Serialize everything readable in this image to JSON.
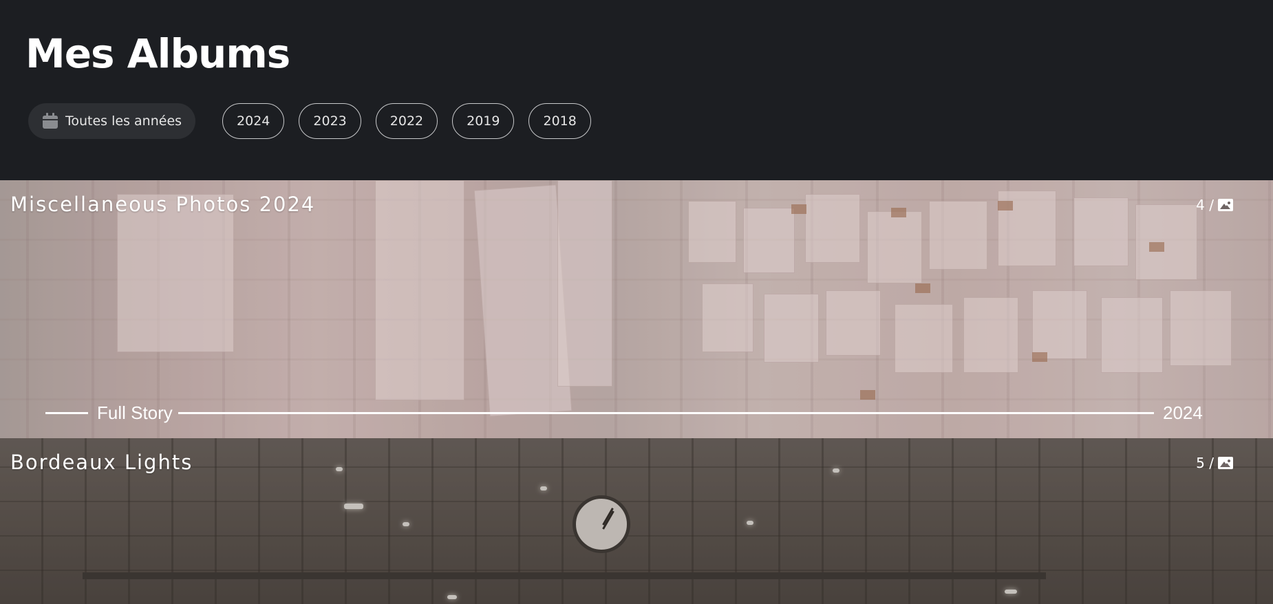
{
  "header": {
    "title": "Mes Albums",
    "filters": {
      "all_years_label": "Toutes les années",
      "all_years_icon": "calendar-icon",
      "years": [
        "2024",
        "2023",
        "2022",
        "2019",
        "2018"
      ]
    }
  },
  "albums": [
    {
      "title": "Miscellaneous Photos 2024",
      "count": "4 /",
      "count_icon": "image-icon",
      "story_label": "Full Story",
      "story_year": "2024"
    },
    {
      "title": "Bordeaux Lights",
      "count": "5 /",
      "count_icon": "image-icon"
    }
  ],
  "colors": {
    "background": "#1c1e22",
    "pill_background": "#2d2f33",
    "pill_border": "#c9cacc",
    "text": "#ffffff"
  }
}
